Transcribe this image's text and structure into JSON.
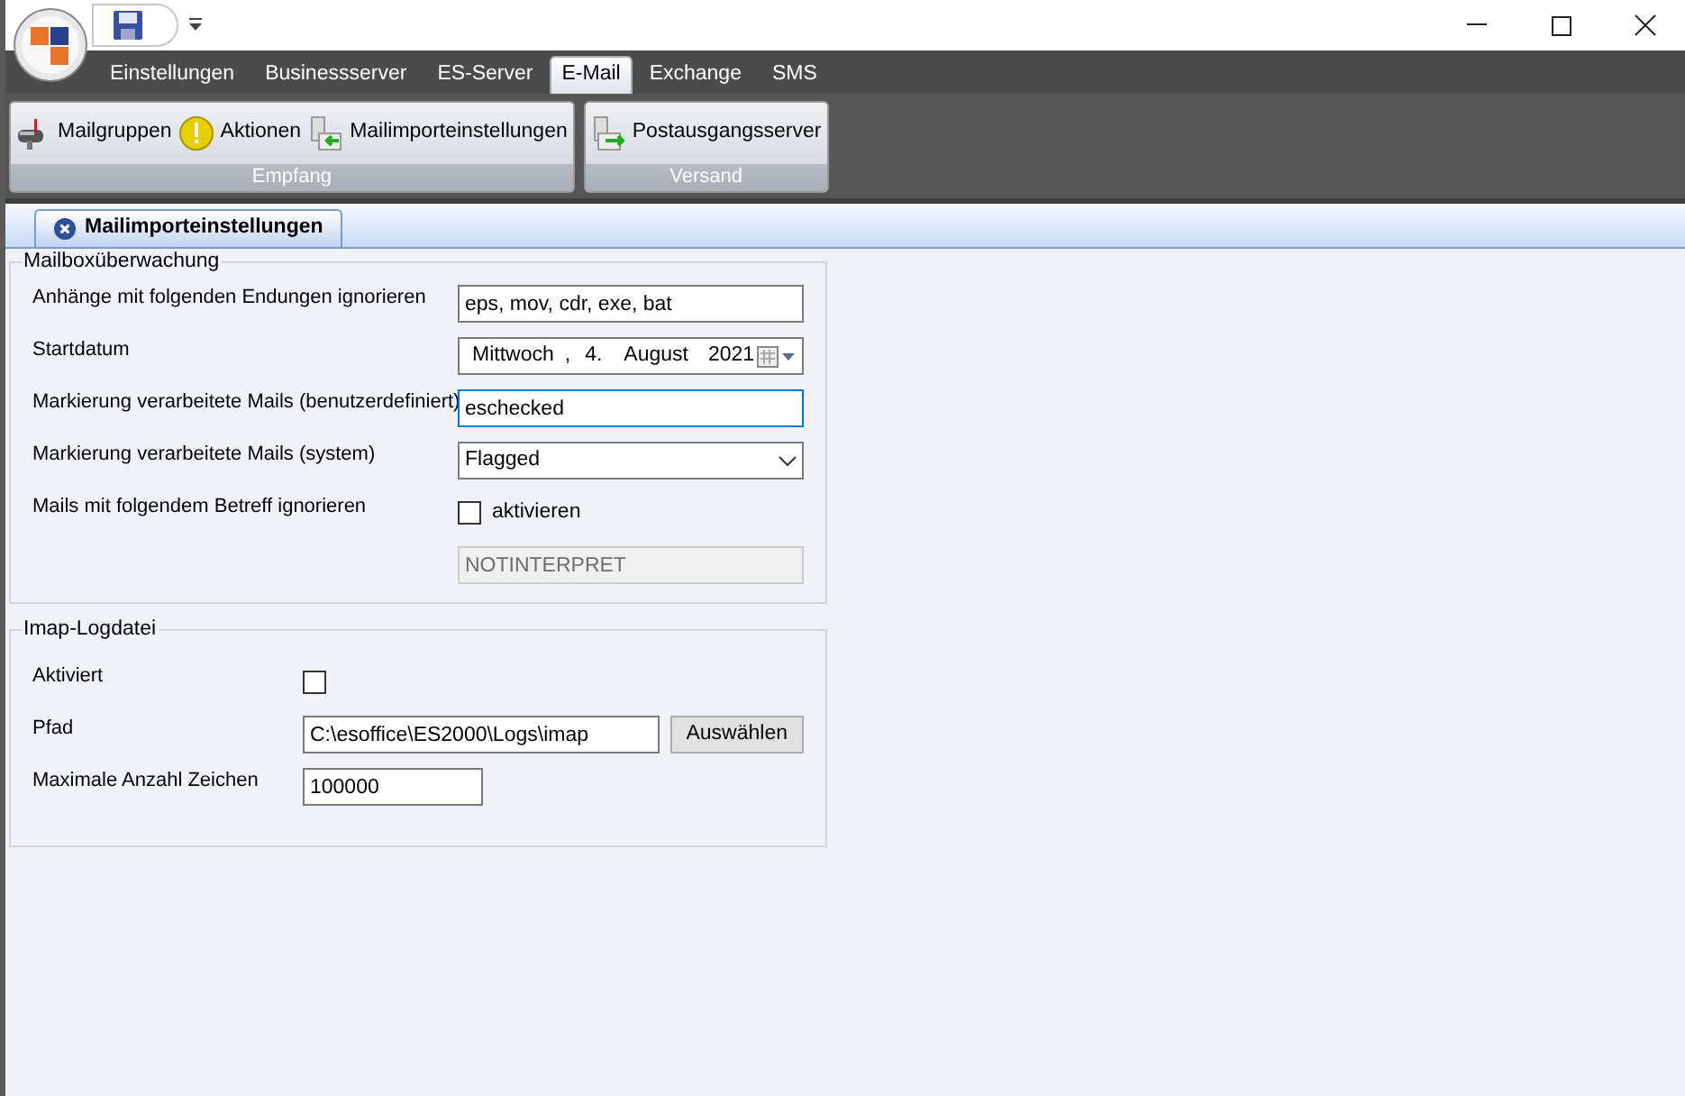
{
  "ribbon_tabs": [
    {
      "label": "Einstellungen",
      "selected": false
    },
    {
      "label": "Businessserver",
      "selected": false
    },
    {
      "label": "ES-Server",
      "selected": false
    },
    {
      "label": "E-Mail",
      "selected": true
    },
    {
      "label": "Exchange",
      "selected": false
    },
    {
      "label": "SMS",
      "selected": false
    }
  ],
  "ribbon_groups": [
    {
      "label": "Empfang",
      "buttons": [
        {
          "label": "Mailgruppen",
          "kind": "mailbox"
        },
        {
          "label": "Aktionen",
          "kind": "warning"
        },
        {
          "label": "Mailimporteinstellungen",
          "kind": "import"
        }
      ]
    },
    {
      "label": "Versand",
      "buttons": [
        {
          "label": "Postausgangsserver",
          "kind": "export"
        }
      ]
    }
  ],
  "doc_tabs": [
    {
      "label": "Mailimporteinstellungen",
      "selected": true
    }
  ],
  "sections": [
    {
      "title": "Mailboxüberwachung",
      "rows": [
        {
          "kind": "text",
          "label": "Anhänge mit folgenden Endungen ignorieren",
          "value": "eps, mov, cdr, exe, bat",
          "focused": false,
          "disabled": false
        },
        {
          "kind": "date",
          "label": "Startdatum",
          "parts": [
            "Mittwoch",
            ",",
            "4.",
            "August",
            "2021"
          ]
        },
        {
          "kind": "text",
          "label": "Markierung verarbeitete Mails (benutzerdefiniert)",
          "value": "eschecked",
          "focused": true,
          "disabled": false
        },
        {
          "kind": "select",
          "label": "Markierung verarbeitete Mails (system)",
          "value": "Flagged"
        },
        {
          "kind": "checkbox",
          "label": "Mails mit folgendem Betreff ignorieren",
          "checked": false,
          "text": "aktivieren"
        },
        {
          "kind": "text",
          "value": "NOTINTERPRET",
          "focused": false,
          "disabled": true
        }
      ]
    },
    {
      "title": "Imap-Logdatei",
      "rows": [
        {
          "kind": "checkbox",
          "label": "Aktiviert",
          "checked": false
        },
        {
          "kind": "text",
          "label": "Pfad",
          "value": "C:\\esoffice\\ES2000\\Logs\\imap",
          "focused": false,
          "disabled": false,
          "button": "Auswählen"
        },
        {
          "kind": "text",
          "label": "Maximale Anzahl Zeichen",
          "value": "100000",
          "focused": false,
          "disabled": false,
          "short": true
        }
      ]
    }
  ]
}
